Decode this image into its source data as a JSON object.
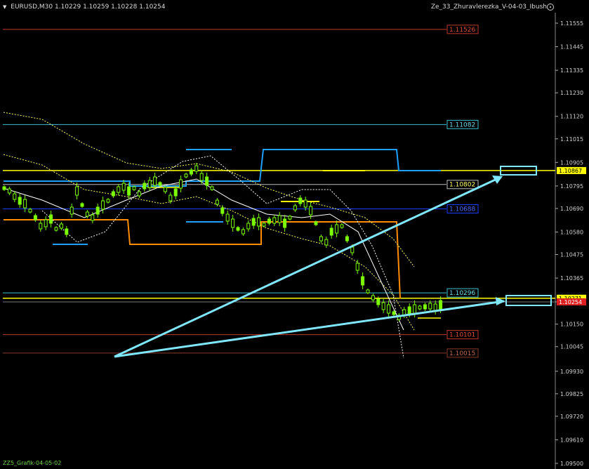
{
  "header": {
    "symbol": "EURUSD,M30",
    "open": "1.10229",
    "high": "1.10259",
    "low": "1.10228",
    "close": "1.10254",
    "indicator_title": "Ze_33_Zhuravlerezka_V-04-03_Ibush",
    "settings_icon": "gear-circle-icon"
  },
  "footer": {
    "label": "ZZ5_Grafik-04-05-02"
  },
  "colors": {
    "background": "#000000",
    "candle": "#7CFC00",
    "up_line": "#FFFF00",
    "cyan_line": "#00BFFF",
    "orange_line": "#FF8C00",
    "arrow": "#7fe7ff"
  },
  "price_axis": {
    "ticks": [
      "1.11555",
      "1.11445",
      "1.11335",
      "1.11230",
      "1.11120",
      "1.11015",
      "1.10905",
      "1.10795",
      "1.10690",
      "1.10580",
      "1.10475",
      "1.10365",
      "1.10254",
      "1.10150",
      "1.10045",
      "1.09930",
      "1.09825",
      "1.09720",
      "1.09610",
      "1.09500"
    ]
  },
  "levels": [
    {
      "label": "1.11526",
      "price": 1.11526,
      "color": "#c0392b",
      "tag_bg": "#000",
      "tag_fg": "#e04a3a",
      "tag_border": "#c0392b"
    },
    {
      "label": "1.11082",
      "price": 1.11082,
      "color": "#3bc0d0",
      "tag_bg": "#000",
      "tag_fg": "#6fd9e6",
      "tag_border": "#3bc0d0"
    },
    {
      "label": "1.10802",
      "price": 1.10802,
      "color": "#bbbbbb",
      "tag_bg": "#000",
      "tag_fg": "#ffff66",
      "tag_border": "#bbbbbb"
    },
    {
      "label": "1.10688",
      "price": 1.10688,
      "color": "#1a3cff",
      "tag_bg": "#000",
      "tag_fg": "#4a66ff",
      "tag_border": "#1a3cff"
    },
    {
      "label": "1.10296",
      "price": 1.10296,
      "color": "#3bc0d0",
      "tag_bg": "#000",
      "tag_fg": "#6fd9e6",
      "tag_border": "#3bc0d0"
    },
    {
      "label": "1.10101",
      "price": 1.10101,
      "color": "#c0392b",
      "tag_bg": "#000",
      "tag_fg": "#e04a3a",
      "tag_border": "#c0392b"
    },
    {
      "label": "1.10015",
      "price": 1.10015,
      "color": "#8b3a2a",
      "tag_bg": "#000",
      "tag_fg": "#c06a55",
      "tag_border": "#8b3a2a"
    }
  ],
  "axis_tags": [
    {
      "label": "1.10867",
      "price": 1.10867,
      "bg": "#ffff00",
      "fg": "#000"
    },
    {
      "label": "1.10271",
      "price": 1.10271,
      "bg": "#ffff00",
      "fg": "#000"
    },
    {
      "label": "1.10254",
      "price": 1.10254,
      "bg": "#e02020",
      "fg": "#fff"
    }
  ]
}
